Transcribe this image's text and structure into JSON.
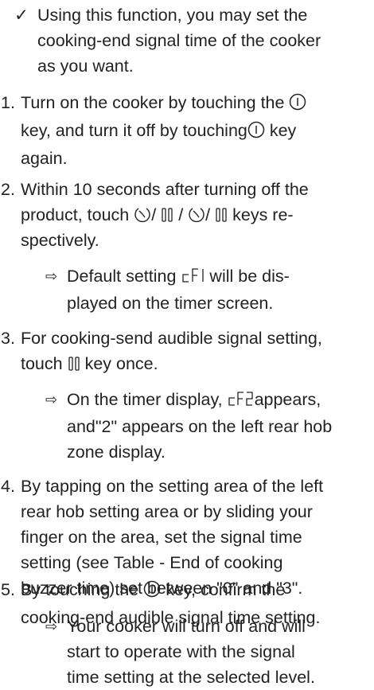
{
  "intro": {
    "mark": "✓",
    "line1": "Using this function, you may set the",
    "line2": "cooking-end signal time of the cooker",
    "line3": "as you want."
  },
  "steps": [
    {
      "num": "1.",
      "a": "Turn on the cooker by touching the",
      "b": "key, and turn it off by touching",
      "c": "key",
      "d": "again."
    },
    {
      "num": "2.",
      "a": "Within 10 seconds after turning off the",
      "b": "product, touch",
      "c": "keys re-",
      "d": "spectively."
    },
    {
      "num": "3.",
      "a": "For cooking-send audible signal setting,",
      "b": "touch",
      "c": "key once."
    },
    {
      "num": "4.",
      "a": "By tapping on the setting area of the left",
      "b": "rear hob setting area or by sliding your",
      "c": "finger on the area, set the signal time",
      "d": "setting (see Table - End of cooking",
      "e": "buzzer time) set between \"0\" and \"3\"."
    },
    {
      "num": "5.",
      "a": "By touching the",
      "b": "key, confirm the",
      "c": "cooking-end audible signal time setting."
    }
  ],
  "results": [
    {
      "arrow": "⇨",
      "a": "Default setting",
      "b": "will be dis-",
      "c": "played on the timer screen."
    },
    {
      "arrow": "⇨",
      "a": "On the timer display,",
      "b": "appears,",
      "c": "and\"2\" appears on the left rear hob",
      "d": "zone display."
    },
    {
      "arrow": "⇨",
      "a": "Your cooker will turn off and will",
      "b": "start to operate with the signal",
      "c": "time setting at the selected level."
    }
  ],
  "separators": {
    "slash": "/"
  }
}
